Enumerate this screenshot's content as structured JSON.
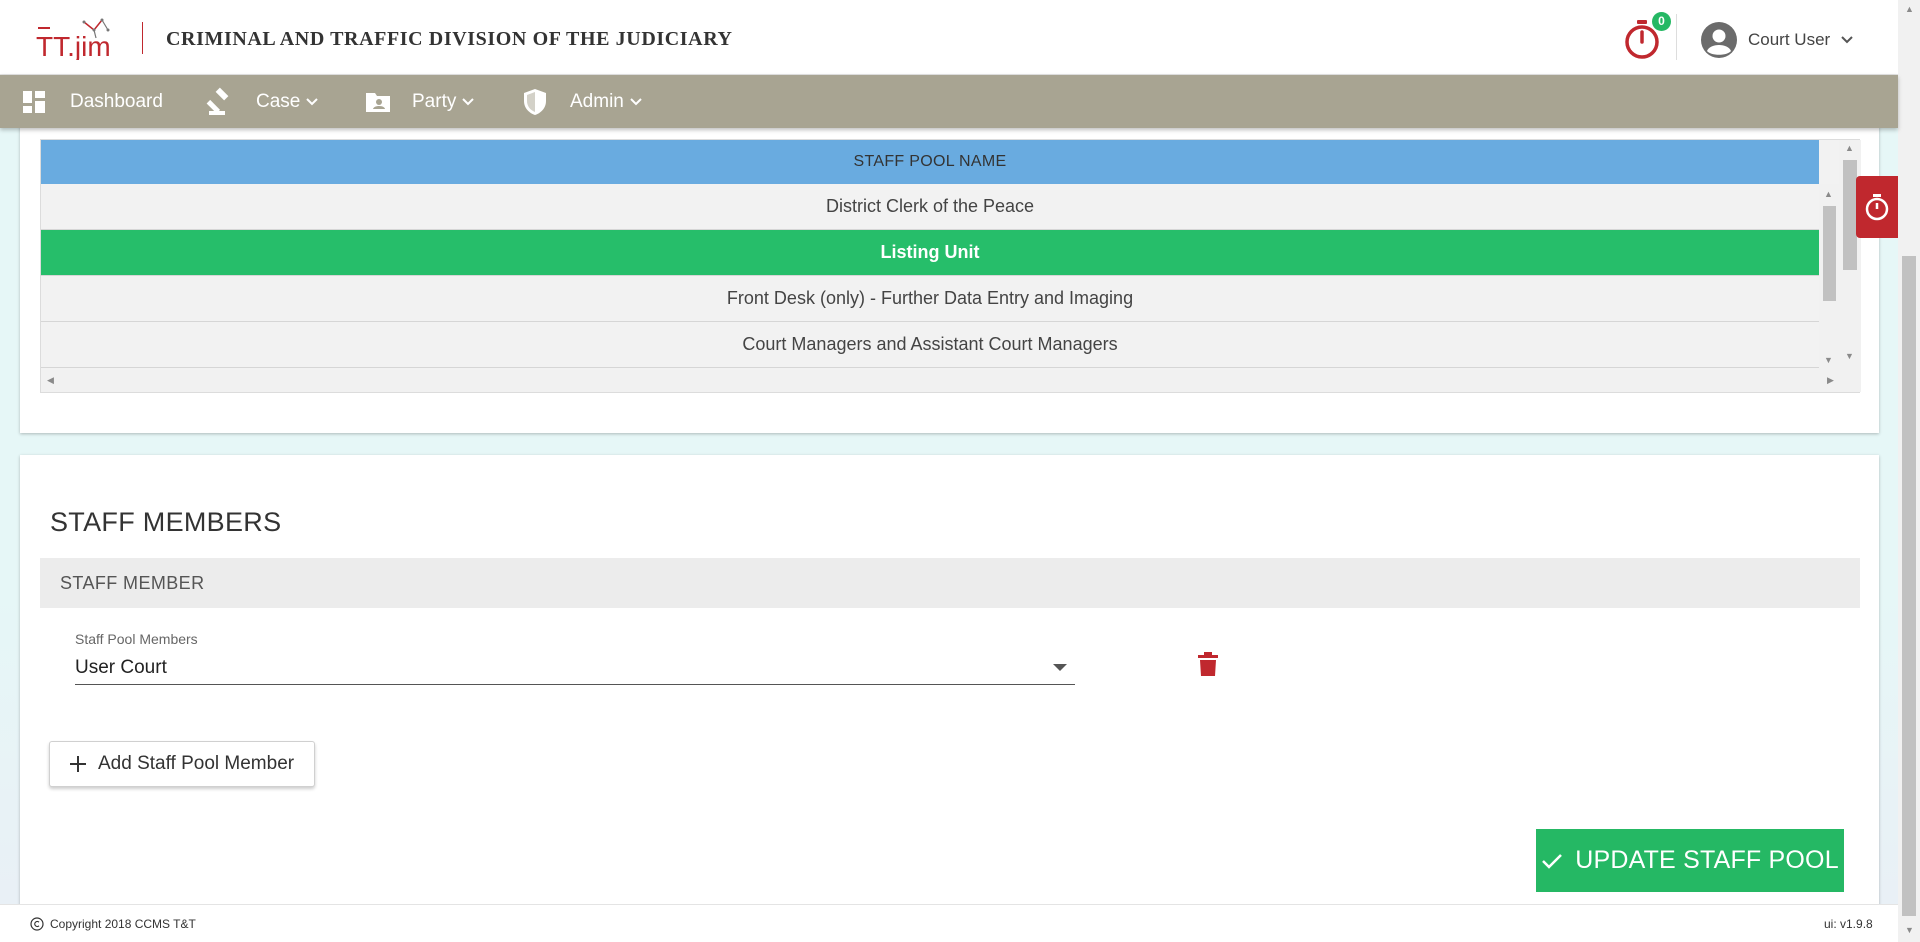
{
  "header": {
    "logo_text": "TT.jim",
    "title": "CRIMINAL AND TRAFFIC DIVISION OF THE JUDICIARY",
    "timer_count": "0",
    "user_name": "Court User"
  },
  "nav": {
    "items": [
      {
        "label": "Dashboard",
        "icon": "dashboard-icon"
      },
      {
        "label": "Case",
        "icon": "gavel-icon"
      },
      {
        "label": "Party",
        "icon": "contact-card-icon"
      },
      {
        "label": "Admin",
        "icon": "shield-icon"
      }
    ]
  },
  "pool_grid": {
    "header": "STAFF POOL NAME",
    "rows": [
      {
        "name": "District Clerk of the Peace",
        "selected": false
      },
      {
        "name": "Listing Unit",
        "selected": true
      },
      {
        "name": "Front Desk (only) - Further Data Entry and Imaging",
        "selected": false
      },
      {
        "name": "Court Managers and Assistant Court Managers",
        "selected": false
      }
    ]
  },
  "members": {
    "section_title": "STAFF MEMBERS",
    "table_header": "STAFF MEMBER",
    "field_label": "Staff Pool Members",
    "field_value": "User Court",
    "add_button": "Add Staff Pool Member",
    "update_button": "UPDATE STAFF POOL"
  },
  "footer": {
    "copyright": "Copyright 2018  CCMS T&T",
    "version": "ui: v1.9.8"
  },
  "colors": {
    "brand_red": "#c0282e",
    "nav_bg": "#a8a492",
    "grid_header": "#69abe0",
    "selected_row": "#26be6a",
    "primary_green": "#25b864"
  }
}
